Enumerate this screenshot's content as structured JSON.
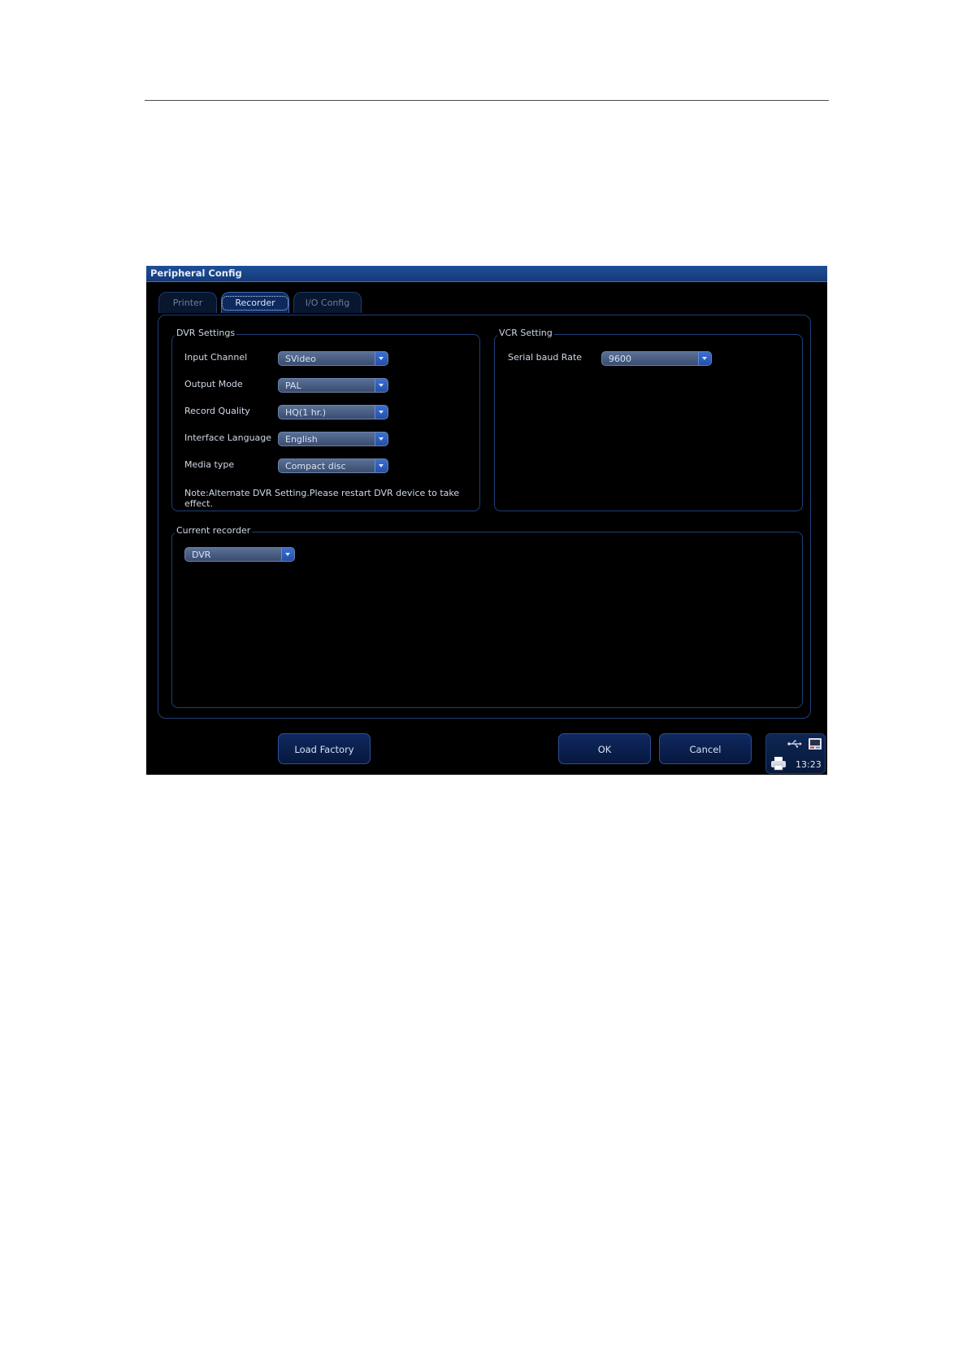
{
  "window": {
    "title": "Peripheral Config"
  },
  "tabs": [
    {
      "label": "Printer",
      "active": false
    },
    {
      "label": "Recorder",
      "active": true
    },
    {
      "label": "I/O Config",
      "active": false
    }
  ],
  "dvr_settings": {
    "title": "DVR Settings",
    "rows": [
      {
        "label": "Input Channel",
        "value": "SVideo"
      },
      {
        "label": "Output Mode",
        "value": "PAL"
      },
      {
        "label": "Record Quality",
        "value": "HQ(1 hr.)"
      },
      {
        "label": "Interface Language",
        "value": "English"
      },
      {
        "label": "Media type",
        "value": "Compact disc"
      }
    ],
    "note": "Note:Alternate DVR Setting.Please restart DVR device to take effect."
  },
  "vcr_setting": {
    "title": "VCR Setting",
    "rows": [
      {
        "label": "Serial baud Rate",
        "value": "9600"
      }
    ]
  },
  "current_recorder": {
    "title": "Current recorder",
    "value": "DVR"
  },
  "buttons": {
    "load_factory": "Load Factory",
    "ok": "OK",
    "cancel": "Cancel"
  },
  "status": {
    "time": "13:23",
    "icons": [
      "usb-icon",
      "media-device-icon",
      "printer-icon"
    ]
  },
  "colors": {
    "screen_bg": "#000000",
    "titlebar": "#1f4f98",
    "frame_border": "#1e3f7a",
    "combo_fill": "#4a5e84",
    "combo_arrow": "#2f5fbf",
    "text": "#d0d8e8"
  }
}
